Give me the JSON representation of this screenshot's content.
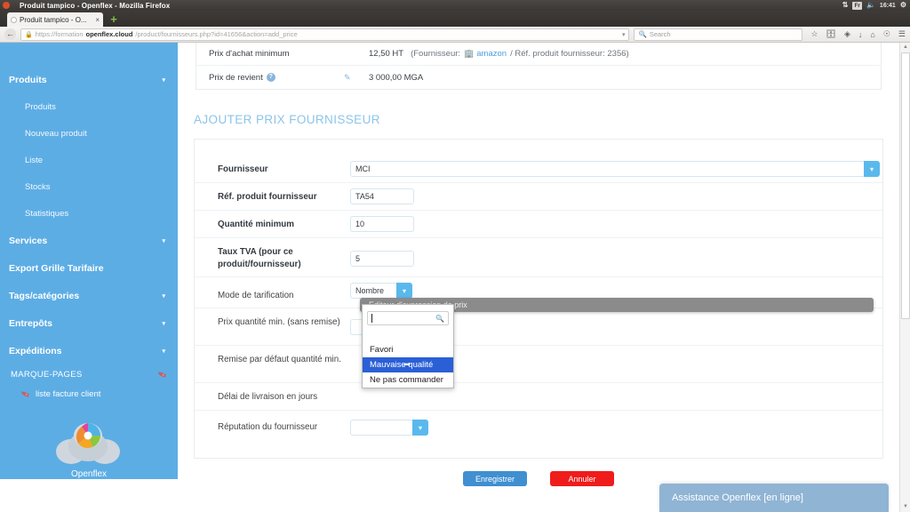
{
  "os": {
    "window_title": "Produit tampico - Openflex - Mozilla Firefox",
    "tray": {
      "network_icon": "network-icon",
      "keyboard_layout": "Fr",
      "volume_icon": "volume-icon",
      "clock": "16:41",
      "settings_icon": "gear-icon"
    }
  },
  "browser": {
    "tab": {
      "title": "Produit tampico - O...",
      "close_label": "×"
    },
    "new_tab_label": "+",
    "back_label": "←",
    "url": {
      "scheme": "https://formation ",
      "prefix": "https://formation",
      "domain": "openflex.cloud",
      "path": "/product/fournisseurs.php?id=41656&action=add_price",
      "lock_icon": "lock-icon",
      "dropdown_icon": "chevron-down-icon"
    },
    "search": {
      "placeholder": "Search",
      "icon": "search-icon"
    },
    "toolbar_icons": [
      "star-icon",
      "save-page-icon",
      "pocket-icon",
      "download-icon",
      "home-icon",
      "sync-icon",
      "menu-icon"
    ]
  },
  "sidebar": {
    "groups": [
      {
        "label": "Produits",
        "caret": "▾"
      },
      {
        "label": "Services",
        "caret": "▾"
      },
      {
        "label": "Export Grille Tarifaire",
        "caret": ""
      },
      {
        "label": "Tags/catégories",
        "caret": "▾"
      },
      {
        "label": "Entrepôts",
        "caret": "▾"
      },
      {
        "label": "Expéditions",
        "caret": "▾"
      }
    ],
    "produits_sub": [
      "Produits",
      "Nouveau produit",
      "Liste",
      "Stocks",
      "Statistiques"
    ],
    "bookmarks": {
      "heading": "MARQUE-PAGES",
      "items": [
        "liste facture client"
      ]
    },
    "brand_name": "Openflex",
    "accent_color": "#5dade5"
  },
  "info": {
    "rows": [
      {
        "label": "Prix d'achat minimum",
        "has_help": false,
        "has_pencil": false,
        "value": "12,50 HT",
        "detail_prefix": "(Fournisseur:",
        "supplier_link": "amazon",
        "detail_suffix": "/ Réf. produit fournisseur: 2356)"
      },
      {
        "label": "Prix de revient",
        "has_help": true,
        "has_pencil": true,
        "value": "3 000,00 MGA",
        "detail_prefix": "",
        "supplier_link": "",
        "detail_suffix": ""
      }
    ]
  },
  "form": {
    "section_title": "AJOUTER PRIX FOURNISSEUR",
    "fields": [
      {
        "label": "Fournisseur",
        "value": "MCI",
        "type": "select-wide"
      },
      {
        "label": "Réf. produit fournisseur",
        "value": "TA54",
        "type": "text"
      },
      {
        "label": "Quantité minimum",
        "value": "10",
        "type": "text"
      },
      {
        "label": "Taux TVA (pour ce produit/fournisseur)",
        "value": "5",
        "type": "text"
      },
      {
        "label": "Mode de tarification",
        "value": "Nombre",
        "type": "select"
      },
      {
        "label": "Prix quantité min. (sans remise)",
        "value": "",
        "type": "select"
      },
      {
        "label": "Remise par défaut quantité min.",
        "value": "",
        "type": "text"
      },
      {
        "label": "Délai de livraison en jours",
        "value": "",
        "type": "text"
      },
      {
        "label": "Réputation du fournisseur",
        "value": "",
        "type": "select"
      }
    ],
    "buttons": {
      "save": "Enregistrer",
      "cancel": "Annuler",
      "save_color": "#3f8fd1",
      "cancel_color": "#f01c1c"
    }
  },
  "expression_editor": {
    "title": "Editeur d'expression de prix"
  },
  "dropdown": {
    "search_value": "",
    "search_icon": "search-icon",
    "options": [
      "Favori",
      "Mauvaise qualité",
      "Ne pas commander"
    ],
    "selected": "Mauvaise qualité",
    "highlight_color": "#2a5fd6"
  },
  "assistance": {
    "label": "Assistance Openflex [en ligne]"
  }
}
